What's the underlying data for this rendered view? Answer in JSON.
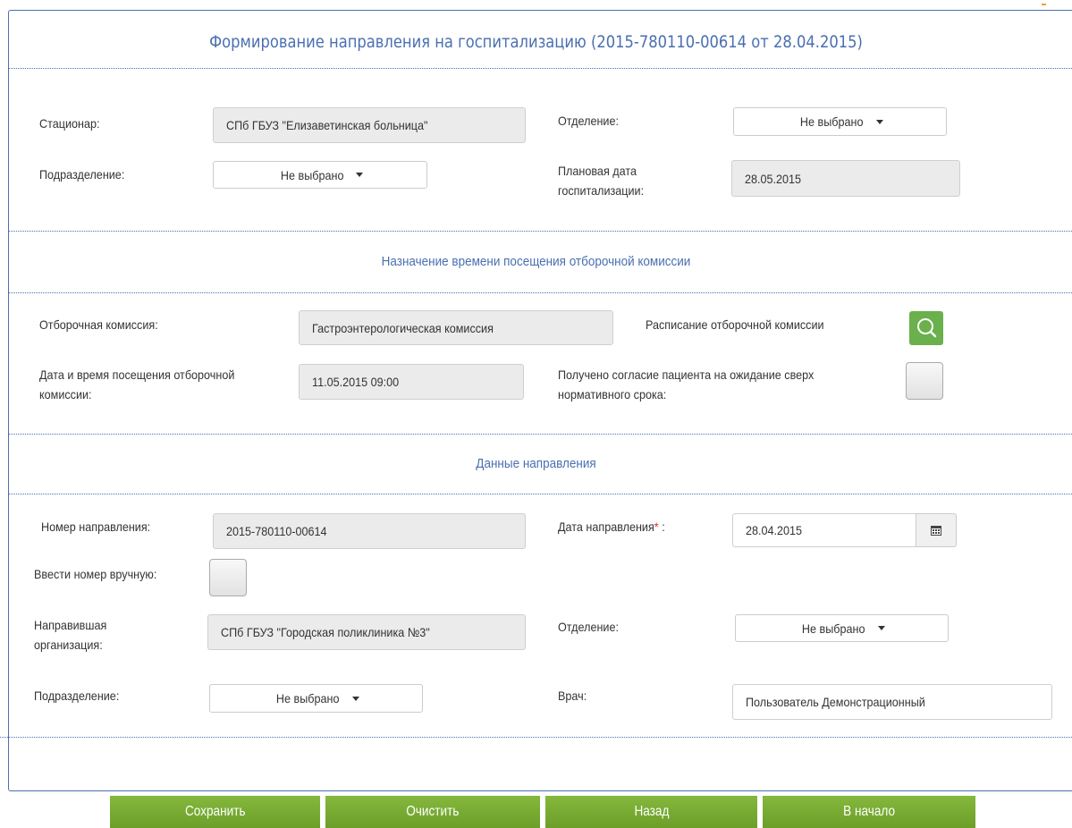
{
  "title": "Формирование направления на госпитализацию (2015-780110-00614 от 28.04.2015)",
  "hospital": {
    "stationary_label": "Стационар:",
    "stationary_value": "СПб ГБУЗ \"Елизаветинская больница\"",
    "department_label": "Отделение:",
    "department_value": "Не выбрано",
    "subdivision_label": "Подразделение:",
    "subdivision_value": "Не выбрано",
    "planned_date_label": "Плановая дата госпитализации:",
    "planned_date_value": "28.05.2015"
  },
  "commission": {
    "section_title": "Назначение времени посещения отборочной комиссии",
    "commission_label": "Отборочная комиссия:",
    "commission_value": "Гастроэнтерологическая комиссия",
    "schedule_label": "Расписание отборочной комиссии",
    "visit_label": "Дата и время посещения отборочной комиссии:",
    "visit_value": "11.05.2015 09:00",
    "consent_label": "Получено согласие пациента на ожидание сверх нормативного срока:"
  },
  "referral": {
    "section_title": "Данные направления",
    "number_label": "Номер направления:",
    "number_value": "2015-780110-00614",
    "date_label": "Дата направления",
    "date_required": "*",
    "date_colon": " :",
    "date_value": "28.04.2015",
    "manual_label": "Ввести номер вручную:",
    "org_label": "Направившая организация:",
    "org_value": "СПб ГБУЗ \"Городская поликлиника №3\"",
    "department_label": "Отделение:",
    "department_value": "Не выбрано",
    "subdivision_label": "Подразделение:",
    "subdivision_value": "Не выбрано",
    "doctor_label": "Врач:",
    "doctor_value": "Пользователь Демонстрационный"
  },
  "buttons": {
    "save": "Сохранить",
    "clear": "Очистить",
    "back": "Назад",
    "home": "В начало"
  },
  "colors": {
    "accent": "#4a6fb0",
    "button_green": "#76a832",
    "required": "#d9342b"
  },
  "icons": {
    "search": "search-icon",
    "calendar": "calendar-icon",
    "caret": "caret-down-icon"
  }
}
